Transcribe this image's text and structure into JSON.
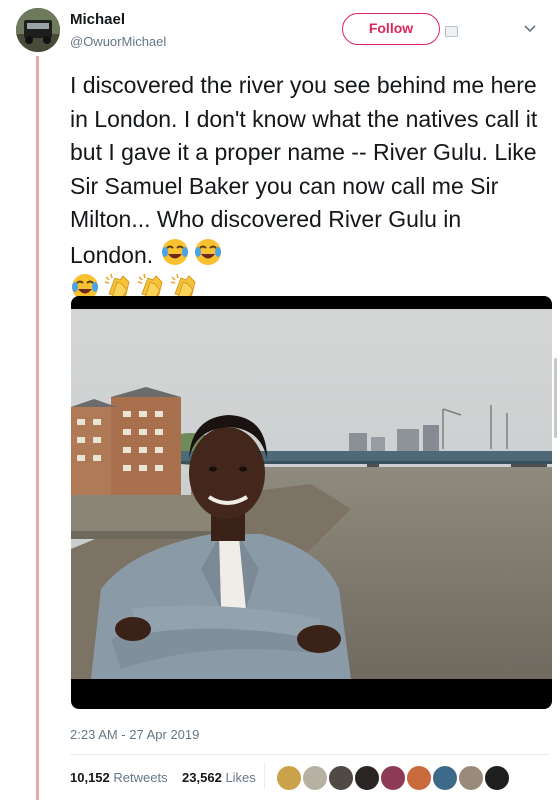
{
  "user": {
    "display_name": "Michael",
    "handle": "@OwuorMichael",
    "avatar_icon": "land-rover-avatar"
  },
  "actions": {
    "follow_label": "Follow",
    "menu_icon": "chevron-down-icon"
  },
  "tweet": {
    "text": "I discovered the river you see behind me here in London. I don't know what the natives call it but I gave it a proper name -- River Gulu. Like Sir Samuel Baker you can now call me Sir Milton... Who discovered River Gulu in London.",
    "emojis": [
      "face-with-tears-of-joy",
      "face-with-tears-of-joy",
      "face-with-tears-of-joy",
      "clapping-hands",
      "clapping-hands",
      "clapping-hands"
    ]
  },
  "media": {
    "photo": "man-with-crossed-arms-by-river-thames"
  },
  "meta": {
    "timestamp": "2:23 AM - 27 Apr 2019"
  },
  "stats": {
    "retweets_count": "10,152",
    "retweets_label": "Retweets",
    "likes_count": "23,562",
    "likes_label": "Likes"
  },
  "colors": {
    "follow_accent": "#e0245e",
    "thread_line": "#e8a9ad",
    "secondary_text": "#657786"
  }
}
